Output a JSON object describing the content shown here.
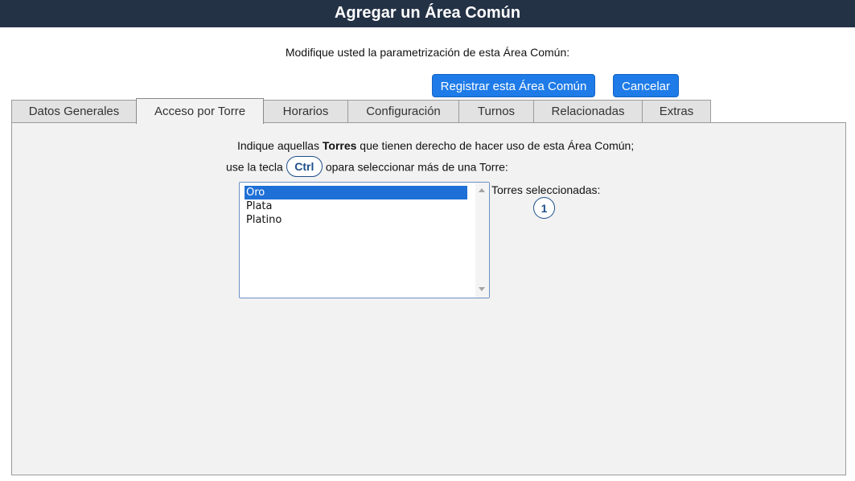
{
  "header": {
    "title": "Agregar un Área Común"
  },
  "subtitle": "Modifique usted la parametrización de esta Área Común:",
  "actions": {
    "register_label": "Registrar esta Área Común",
    "cancel_label": "Cancelar"
  },
  "tabs": [
    {
      "label": "Datos Generales",
      "active": false
    },
    {
      "label": "Acceso por Torre",
      "active": true
    },
    {
      "label": "Horarios",
      "active": false
    },
    {
      "label": "Configuración",
      "active": false
    },
    {
      "label": "Turnos",
      "active": false
    },
    {
      "label": "Relacionadas",
      "active": false
    },
    {
      "label": "Extras",
      "active": false
    }
  ],
  "panel": {
    "instruction_part1": "Indique aquellas ",
    "instruction_bold": "Torres",
    "instruction_part2": " que tienen derecho de hacer uso de esta Área Común;",
    "instruction2_before": "use la tecla",
    "ctrl_key": "Ctrl",
    "instruction2_after": "opara seleccionar más de una Torre:",
    "towers": [
      {
        "label": "Oro",
        "selected": true
      },
      {
        "label": "Plata",
        "selected": false
      },
      {
        "label": "Platino",
        "selected": false
      }
    ],
    "selected_label": "Torres seleccionadas:",
    "selected_count": "1"
  },
  "colors": {
    "header_bg": "#243246",
    "button_bg": "#1e7be8",
    "selection_bg": "#1e6fd6",
    "badge_border": "#1d4f8a"
  }
}
